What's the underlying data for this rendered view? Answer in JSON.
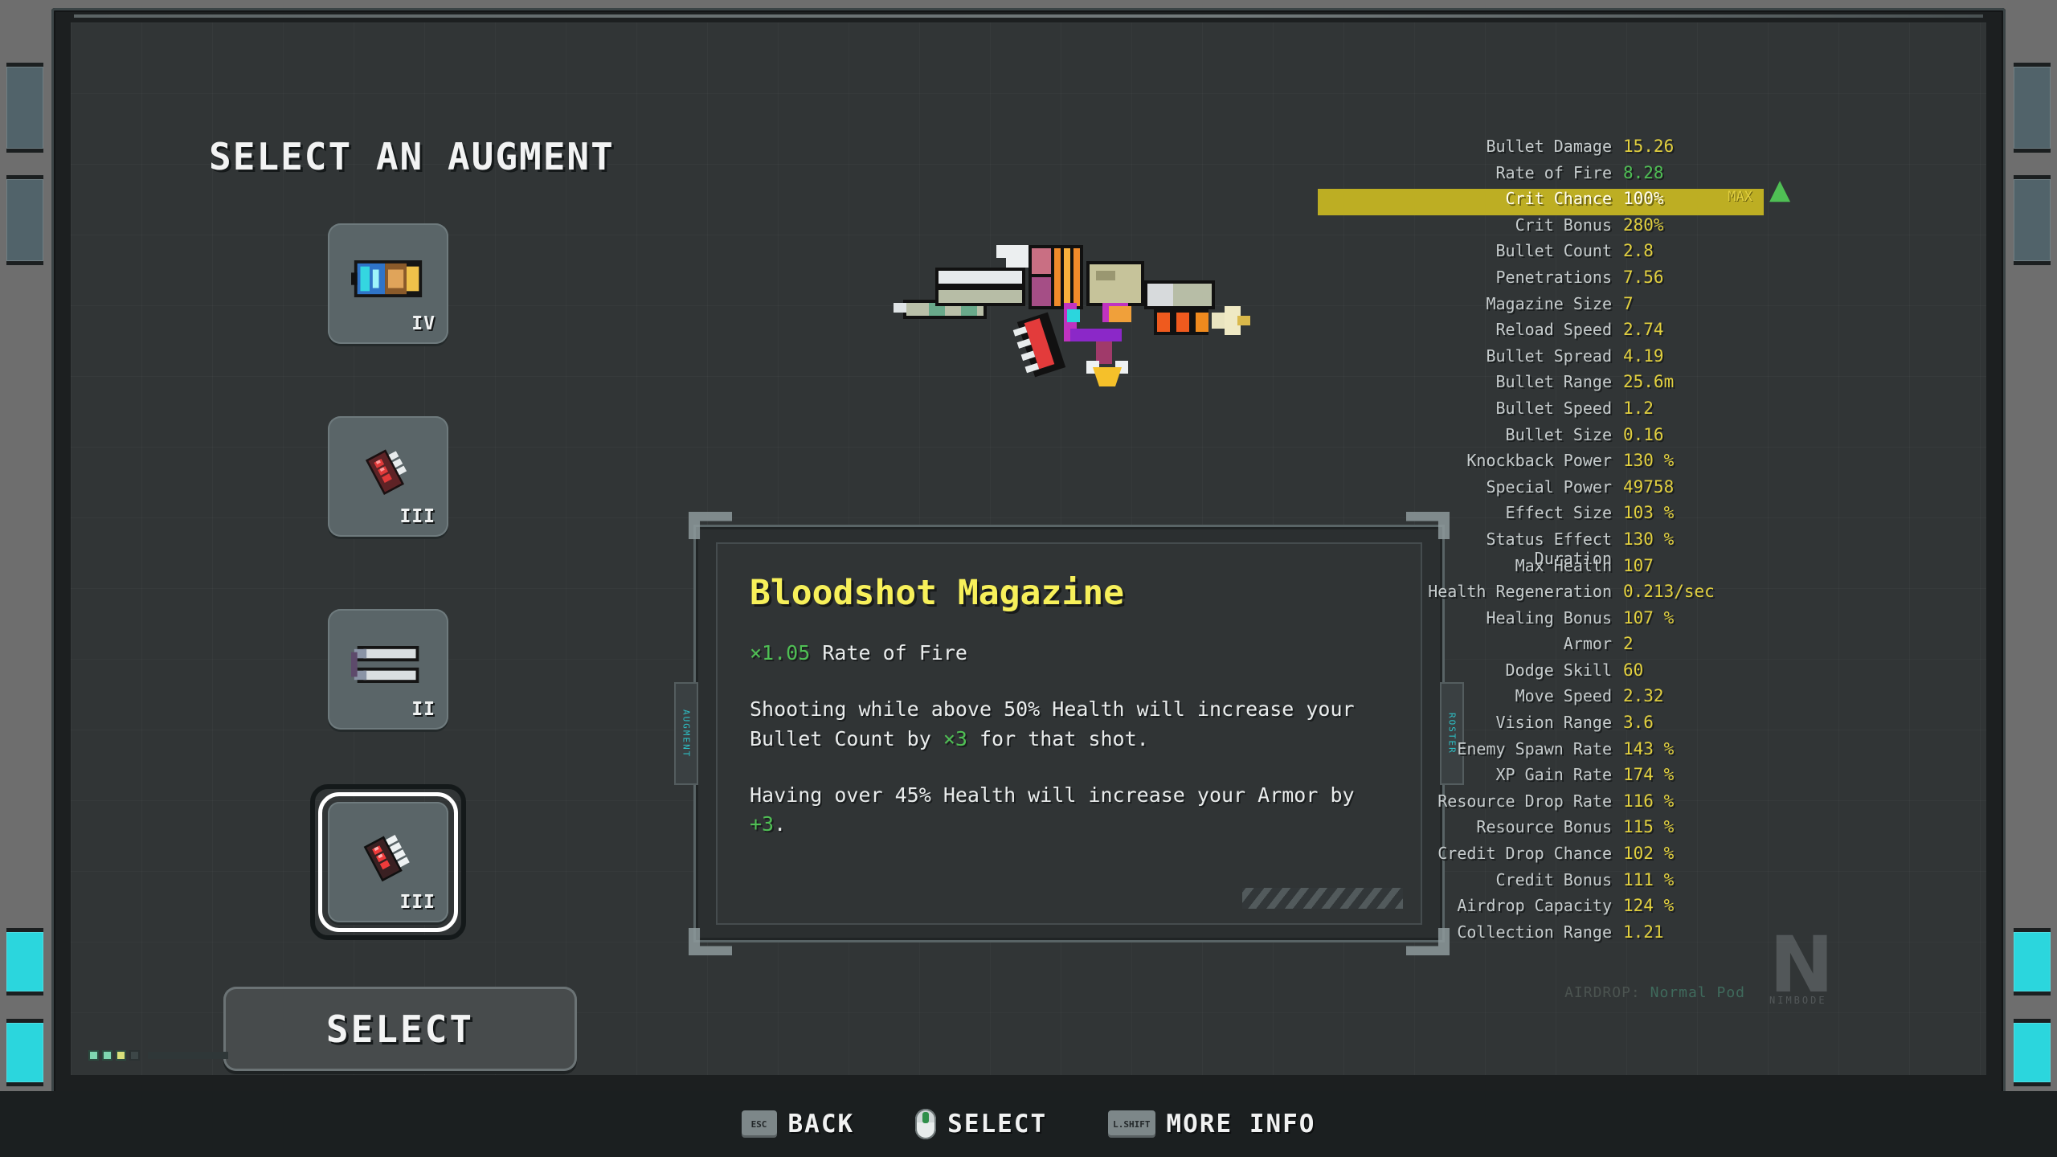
{
  "page_title": "SELECT AN AUGMENT",
  "augment_list": [
    {
      "level": "IV",
      "icon": "magazine-cyan-icon",
      "selected": false
    },
    {
      "level": "III",
      "icon": "magazine-red-icon",
      "selected": false
    },
    {
      "level": "II",
      "icon": "bullet-silver-icon",
      "selected": false
    },
    {
      "level": "III",
      "icon": "magazine-red-icon",
      "selected": true
    }
  ],
  "dialog": {
    "title": "Bloodshot Magazine",
    "modifier_value": "×1.05",
    "modifier_stat": " Rate of Fire",
    "effect_1_pre": "Shooting while above 50% Health will increase your Bullet Count by ",
    "effect_1_value": "×3",
    "effect_1_post": " for that shot.",
    "effect_2_pre": "Having over 45% Health will increase your Armor by ",
    "effect_2_value": "+3",
    "effect_2_post": ".",
    "tab_left_label": "AUGMENT",
    "tab_right_label": "ROSTER"
  },
  "select_button": {
    "label": "SELECT"
  },
  "stats": {
    "highlight_tag": "MAX",
    "rows": [
      {
        "name": "Bullet Damage",
        "value": "15.26",
        "state": "normal"
      },
      {
        "name": "Rate of Fire",
        "value": "8.28",
        "state": "up"
      },
      {
        "name": "Crit Chance",
        "value": "100%",
        "state": "highlight"
      },
      {
        "name": "Crit Bonus",
        "value": "280%",
        "state": "normal"
      },
      {
        "name": "Bullet Count",
        "value": "2.8",
        "state": "normal"
      },
      {
        "name": "Penetrations",
        "value": "7.56",
        "state": "normal"
      },
      {
        "name": "Magazine Size",
        "value": "7",
        "state": "normal"
      },
      {
        "name": "Reload Speed",
        "value": "2.74",
        "state": "normal"
      },
      {
        "name": "Bullet Spread",
        "value": "4.19",
        "state": "normal"
      },
      {
        "name": "Bullet Range",
        "value": "25.6m",
        "state": "normal"
      },
      {
        "name": "Bullet Speed",
        "value": "1.2",
        "state": "normal"
      },
      {
        "name": "Bullet Size",
        "value": "0.16",
        "state": "normal"
      },
      {
        "name": "Knockback Power",
        "value": "130 %",
        "state": "normal"
      },
      {
        "name": "Special Power",
        "value": "49758",
        "state": "normal"
      },
      {
        "name": "Effect Size",
        "value": "103 %",
        "state": "normal"
      },
      {
        "name": "Status Effect Duration",
        "value": "130 %",
        "state": "normal"
      },
      {
        "name": "Max Health",
        "value": "107",
        "state": "normal"
      },
      {
        "name": "Health Regeneration",
        "value": "0.213/sec",
        "state": "normal"
      },
      {
        "name": "Healing Bonus",
        "value": "107 %",
        "state": "normal"
      },
      {
        "name": "Armor",
        "value": "2",
        "state": "normal"
      },
      {
        "name": "Dodge Skill",
        "value": "60",
        "state": "normal"
      },
      {
        "name": "Move Speed",
        "value": "2.32",
        "state": "normal"
      },
      {
        "name": "Vision Range",
        "value": "3.6",
        "state": "normal"
      },
      {
        "name": "Enemy Spawn Rate",
        "value": "143 %",
        "state": "normal"
      },
      {
        "name": "XP Gain Rate",
        "value": "174 %",
        "state": "normal"
      },
      {
        "name": "Resource Drop Rate",
        "value": "116 %",
        "state": "normal"
      },
      {
        "name": "Resource Bonus",
        "value": "115 %",
        "state": "normal"
      },
      {
        "name": "Credit Drop Chance",
        "value": "102 %",
        "state": "normal"
      },
      {
        "name": "Credit Bonus",
        "value": "111 %",
        "state": "normal"
      },
      {
        "name": "Airdrop Capacity",
        "value": "124 %",
        "state": "normal"
      },
      {
        "name": "Collection Range",
        "value": "1.21",
        "state": "normal"
      }
    ]
  },
  "airdrop": {
    "label": "AIRDROP:",
    "value": "Normal Pod"
  },
  "brand": {
    "mark": "N",
    "wordmark": "NIMBODE"
  },
  "hints": [
    {
      "key": "ESC",
      "key_type": "keycap",
      "label": "BACK"
    },
    {
      "key": "",
      "key_type": "mouse",
      "label": "SELECT"
    },
    {
      "key": "L.SHIFT",
      "key_type": "keycap",
      "label": "MORE INFO"
    }
  ],
  "colors": {
    "accent_yellow": "#e2d03f",
    "highlight_bar": "#bdae23",
    "positive_green": "#4fbf54",
    "title_yellow": "#f7f05a",
    "vent_cyan": "#2bd6dd"
  }
}
